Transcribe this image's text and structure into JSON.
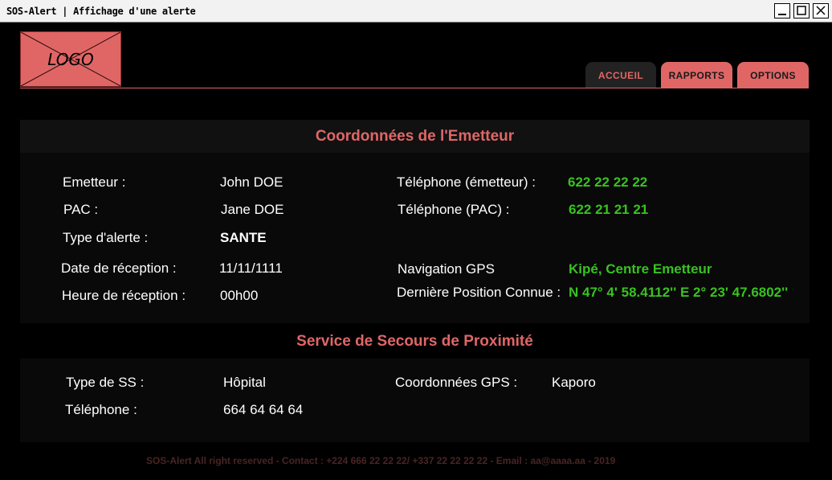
{
  "window": {
    "title": "SOS-Alert | Affichage d'une alerte",
    "controls": [
      "minimize-icon",
      "maximize-icon",
      "close-icon"
    ]
  },
  "header": {
    "logo_text": "LOGO",
    "tabs": [
      {
        "label": "ACCUEIL",
        "active": true
      },
      {
        "label": "RAPPORTS",
        "active": false
      },
      {
        "label": "OPTIONS",
        "active": false
      }
    ]
  },
  "emitter": {
    "title": "Coordonnées de l'Emetteur",
    "emetteur_label": "Emetteur :",
    "emetteur_value": "John DOE",
    "pac_label": "PAC :",
    "pac_value": "Jane DOE",
    "type_label": "Type d'alerte :",
    "type_value": "SANTE",
    "date_label": "Date de réception :",
    "date_value": "11/11/1111",
    "heure_label": "Heure de réception :",
    "heure_value": "00h00",
    "tel_emetteur_label": "Téléphone (émetteur) :",
    "tel_emetteur_value": "622 22 22 22",
    "tel_pac_label": "Téléphone (PAC) :",
    "tel_pac_value": "622 21 21 21",
    "nav_label": "Navigation GPS",
    "nav_value": "Kipé, Centre Emetteur",
    "position_label": "Dernière Position Connue :",
    "position_value": "N 47° 4' 58.4112'' E 2° 23' 47.6802''"
  },
  "service": {
    "title": "Service de Secours de Proximité",
    "type_label": "Type de SS :",
    "type_value": "Hôpital",
    "tel_label": "Téléphone :",
    "tel_value": "664 64 64 64",
    "gps_label": "Coordonnées GPS :",
    "gps_value": "Kaporo"
  },
  "footer": {
    "text": "SOS-Alert All right reserved - Contact : +224 666 22 22 22/ +337 22 22 22 22 - Email : aa@aaaa.aa - 2019"
  },
  "colors": {
    "accent": "#e06666",
    "value_green": "#38c21f",
    "background": "#000000"
  }
}
